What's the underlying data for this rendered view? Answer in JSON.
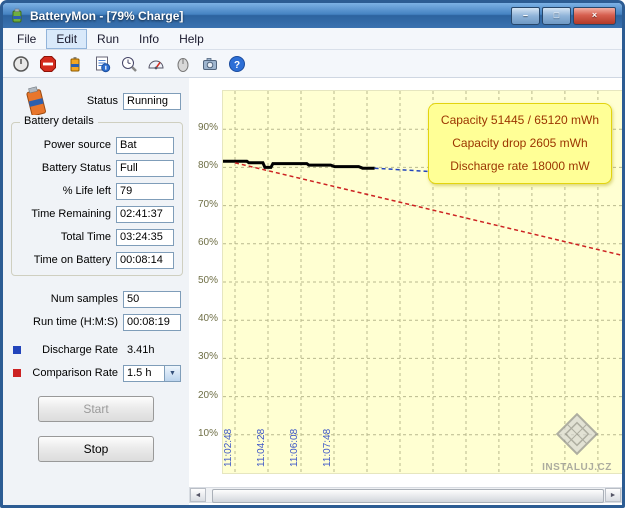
{
  "window": {
    "title": "BatteryMon - [79% Charge]"
  },
  "menu": {
    "items": [
      "File",
      "Edit",
      "Run",
      "Info",
      "Help"
    ],
    "active_item": "Edit"
  },
  "toolbar": {
    "icons": [
      "power-icon",
      "stop-sign-icon",
      "battery-icon",
      "report-icon",
      "history-icon",
      "gauge-icon",
      "pointer-icon",
      "snapshot-icon",
      "help-icon"
    ]
  },
  "panel": {
    "status_label": "Status",
    "status_value": "Running",
    "battery_details_legend": "Battery details",
    "details_rows": [
      {
        "label": "Power source",
        "value": "Bat"
      },
      {
        "label": "Battery Status",
        "value": "Full"
      },
      {
        "label": "% Life left",
        "value": "79"
      },
      {
        "label": "Time Remaining",
        "value": "02:41:37"
      },
      {
        "label": "Total Time",
        "value": "03:24:35"
      },
      {
        "label": "Time on Battery",
        "value": "00:08:14"
      }
    ],
    "num_samples_label": "Num samples",
    "num_samples_value": "50",
    "run_time_label": "Run time (H:M:S)",
    "run_time_value": "00:08:19",
    "discharge_rate_label": "Discharge Rate",
    "discharge_rate_value": "3.41h",
    "comparison_rate_label": "Comparison Rate",
    "comparison_rate_value": "1.5 h",
    "start_button": "Start",
    "stop_button": "Stop"
  },
  "chart_data": {
    "type": "line",
    "title": "",
    "ylim": [
      0,
      100
    ],
    "y_ticks": [
      90,
      80,
      70,
      60,
      50,
      40,
      30,
      20,
      10
    ],
    "y_tick_labels": [
      "90%",
      "80%",
      "70%",
      "60%",
      "50%",
      "40%",
      "30%",
      "20%",
      "10%"
    ],
    "x_tick_labels": [
      "11:02:48",
      "11:04:28",
      "11:06:08",
      "11:07:48"
    ],
    "x_grid_start_frac": 0.03,
    "x_grid_step_frac": 0.0827,
    "grid_color": "#b9b98e",
    "annotations": [
      "Capacity 51445 / 65120 mWh",
      "Capacity drop 2605 mWh",
      "Discharge rate 18000 mW"
    ],
    "series": [
      {
        "name": "charge-actual",
        "color": "#000000",
        "dash": "none",
        "width": 3,
        "points": [
          [
            0,
            81.6
          ],
          [
            0.06,
            81.6
          ],
          [
            0.065,
            81.2
          ],
          [
            0.1,
            81.2
          ],
          [
            0.105,
            80.0
          ],
          [
            0.12,
            80.0
          ],
          [
            0.125,
            81.0
          ],
          [
            0.21,
            81.0
          ],
          [
            0.215,
            80.6
          ],
          [
            0.27,
            80.6
          ],
          [
            0.28,
            80.2
          ],
          [
            0.34,
            80.2
          ],
          [
            0.35,
            79.8
          ],
          [
            0.38,
            79.8
          ]
        ]
      },
      {
        "name": "discharge-rate-projection",
        "color": "#2244bb",
        "dash": "4,3",
        "width": 1.5,
        "points": [
          [
            0.38,
            79.8
          ],
          [
            0.6,
            78.4
          ]
        ]
      },
      {
        "name": "comparison-rate-1.5h",
        "color": "#cc2222",
        "dash": "4,3",
        "width": 1.5,
        "points": [
          [
            0.03,
            81.2
          ],
          [
            1.0,
            57.0
          ]
        ]
      }
    ]
  },
  "watermark": {
    "text": "INSTALUJ.CZ"
  }
}
